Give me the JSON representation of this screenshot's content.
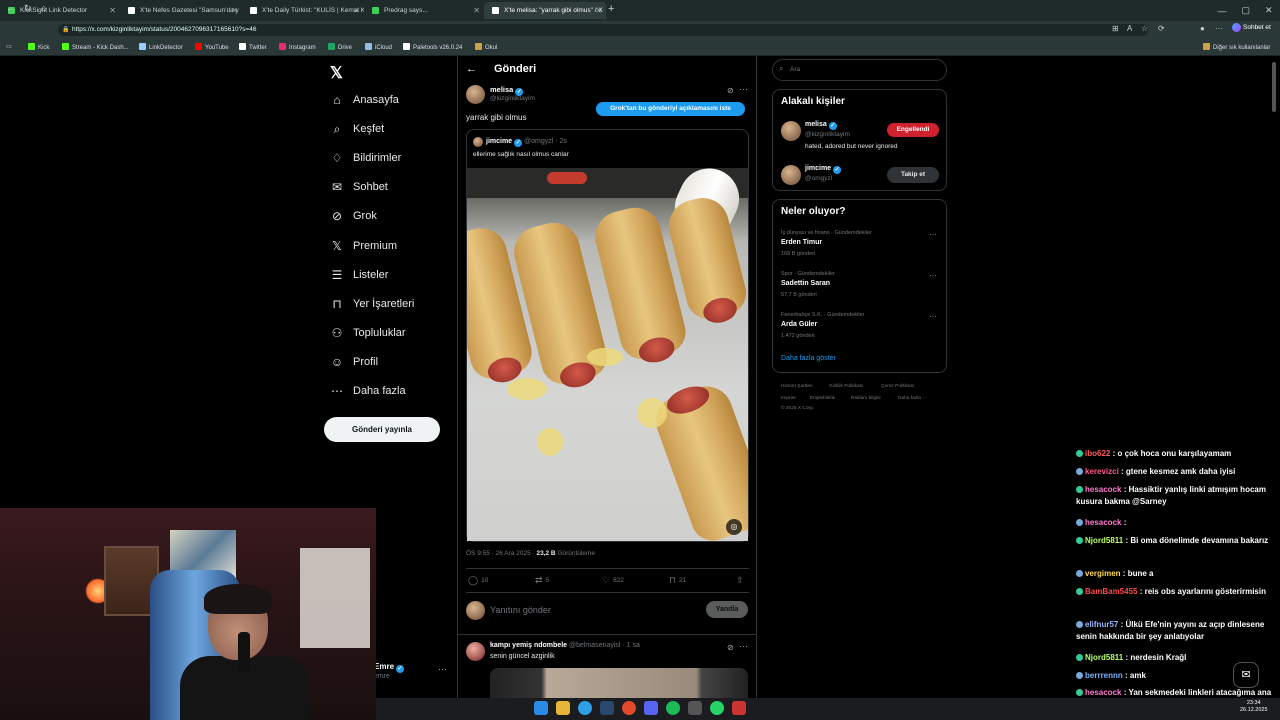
{
  "browser": {
    "tabs": [
      {
        "label": "KickSight Link Detector",
        "color": "#3fd05a"
      },
      {
        "label": "X'te Nefes Gazetesi \"Samsun'da y",
        "color": "#ffffff"
      },
      {
        "label": "X'te Daily Türkist: \"KULİS | Kemal K",
        "color": "#ffffff"
      },
      {
        "label": "Predrag says...",
        "color": "#3fd05a"
      },
      {
        "label": "X'te melisa: \"yarrak gibi olmus\" / X",
        "color": "#ffffff"
      }
    ],
    "url": "https://x.com/kizginliktayim/status/2004627096317165610?s=46",
    "copilot_label": "Sohbet et",
    "bookmarks": [
      "Kick",
      "Stream - Kick Dash...",
      "LinkDetector",
      "YouTube",
      "Twitter",
      "Instagram",
      "Drive",
      "iCloud",
      "Paletools v26.0.24",
      "Okul"
    ],
    "other_bookmarks": "Diğer sık kullanılanlar"
  },
  "nav": {
    "items": [
      "Anasayfa",
      "Keşfet",
      "Bildirimler",
      "Sohbet",
      "Grok",
      "Premium",
      "Listeler",
      "Yer İşaretleri",
      "Topluluklar",
      "Profil",
      "Daha fazla"
    ],
    "post_button": "Gönderi yayınla",
    "account_name": "Emre",
    "account_handle": "emre"
  },
  "post": {
    "header": "Gönderi",
    "author_name": "melisa",
    "author_handle": "@kizginliktayim",
    "grok_explain": "Grok'tan bu gönderiyi açıklamasını iste",
    "text": "yarrak gibi olmus",
    "quote": {
      "name": "jimcime",
      "handle": "@omgyzl",
      "time": "· 2s",
      "text": "ellerime sağlık nasıl olmus canlar"
    },
    "meta_time": "ÖS 9:55 · 26 Ara 2025 ·",
    "meta_views": "23,2 B",
    "meta_views_label": "Görüntüleme",
    "actions": {
      "replies": "10",
      "reposts": "5",
      "likes": "822",
      "bookmarks": "21"
    },
    "reply_placeholder": "Yanıtını gönder",
    "reply_button": "Yanıtla",
    "reply": {
      "name": "kampı yemiş ndombele",
      "handle": "@belmasenayisl",
      "time": "· 1 sa",
      "text": "senin güncel azginlik"
    }
  },
  "sidebar": {
    "search_placeholder": "Ara",
    "related_title": "Alakalı kişiler",
    "people": [
      {
        "name": "melisa",
        "handle": "@kizginliktayim",
        "bio": "hated, adored but never ignored",
        "button": "Engellendi"
      },
      {
        "name": "jimcime",
        "handle": "@omgyzl",
        "bio": "",
        "button": "Takip et"
      }
    ],
    "trends_title": "Neler oluyor?",
    "trends": [
      {
        "category": "İş dünyası ve finans · Gündemdekiler",
        "name": "Erden Timur",
        "count": "168 B gönderi"
      },
      {
        "category": "Spor · Gündemdekiler",
        "name": "Sadettin Saran",
        "count": "57,7 B gönderi"
      },
      {
        "category": "Fenerbahçe S.K. · Gündemdekiler",
        "name": "Arda Güler",
        "count": "1.472 gönderi"
      }
    ],
    "show_more": "Daha fazla göster",
    "footer": [
      "Hizmet Şartları",
      "Gizlilik Politikası",
      "Çerez Politikası",
      "Imprint",
      "Erişilebilirlik",
      "Reklam bilgisi",
      "Daha fazla ···",
      "© 2025 X Corp."
    ]
  },
  "chat": [
    {
      "user": "ibo622",
      "msg": "o çok hoca onu karşılayamam",
      "color": "#ff5a5a"
    },
    {
      "user": "kerevizci",
      "msg": "gtene kesmez amk daha iyisi",
      "color": "#ff5a8a"
    },
    {
      "user": "hesacock",
      "msg": "Hassiktir yanlış linki atmışım hocam kusura bakma @Sarney",
      "color": "#ff7ad0"
    },
    {
      "user": "hesacock",
      "msg": "",
      "color": "#ff7ad0"
    },
    {
      "user": "Njord5811",
      "msg": "Bi oma dönelimde devamına bakarız",
      "color": "#b6ff6a"
    },
    {
      "user": "vergimen",
      "msg": "bune a",
      "color": "#ffd84a"
    },
    {
      "user": "BamBam5455",
      "msg": "reis obs ayarlarını gösterirmisin",
      "color": "#ff4a4a"
    },
    {
      "user": "elifnur57",
      "msg": "Ülkü Efe'nin yayını az açıp dinlesene senin hakkında bir şey anlatıyolar",
      "color": "#9ab8ff"
    },
    {
      "user": "Njord5811",
      "msg": "nerdesin Krağl",
      "color": "#b6ff6a"
    },
    {
      "user": "berrrennn",
      "msg": "amk",
      "color": "#7ab0ff"
    },
    {
      "user": "hesacock",
      "msg": "Yan sekmedeki linkleri atacağıma ana ekrandakini kopyalamışım",
      "color": "#ff7ad0"
    }
  ],
  "clock": {
    "time": "23:34",
    "date": "26.12.2025"
  }
}
